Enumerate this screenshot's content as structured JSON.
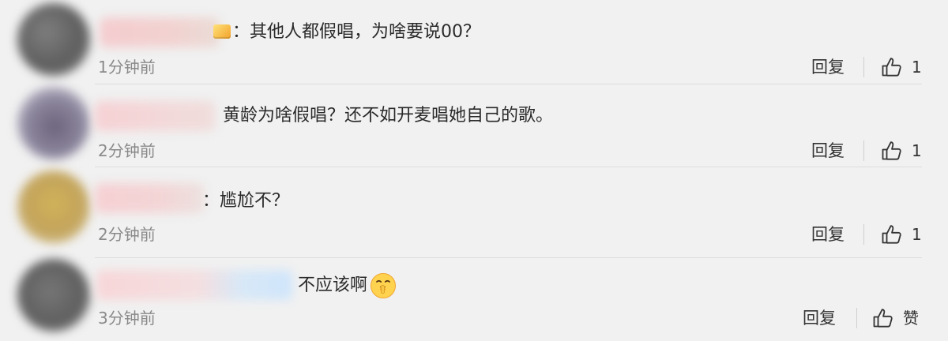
{
  "comments": [
    {
      "text": "：其他人都假唱，为啥要说00？",
      "timestamp": "1分钟前",
      "reply_label": "回复",
      "like_label": "1"
    },
    {
      "text": "黄龄为啥假唱？还不如开麦唱她自己的歌。",
      "timestamp": "2分钟前",
      "reply_label": "回复",
      "like_label": "1"
    },
    {
      "text": "：尴尬不？",
      "timestamp": "2分钟前",
      "reply_label": "回复",
      "like_label": "1"
    },
    {
      "text": "不应该啊",
      "timestamp": "3分钟前",
      "reply_label": "回复",
      "like_label": "赞"
    }
  ],
  "icons": {
    "like": "thumbs-up-icon",
    "emoji": "shush-face-icon"
  },
  "colors": {
    "background": "#f1f1f1",
    "text": "#2a2a2a",
    "muted_text": "#8a8a8a",
    "divider": "#dcdcdc"
  }
}
